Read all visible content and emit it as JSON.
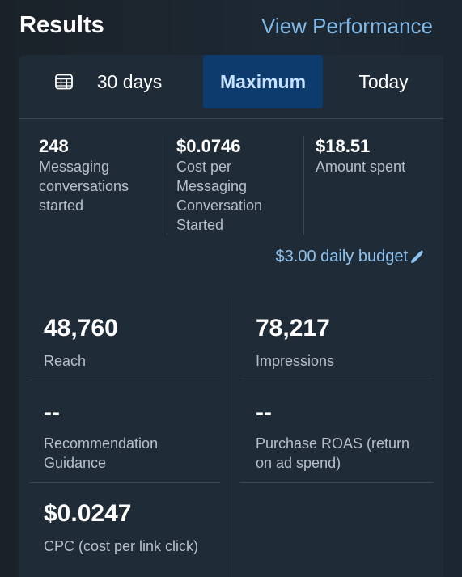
{
  "header": {
    "title": "Results",
    "link": "View Performance"
  },
  "tabs": [
    {
      "label": "30 days",
      "icon": "calendar-icon"
    },
    {
      "label": "Maximum",
      "selected": true
    },
    {
      "label": "Today"
    }
  ],
  "summary": [
    {
      "value": "248",
      "label": "Messaging conversations started"
    },
    {
      "value": "$0.0746",
      "label": "Cost per Messaging Conversation Started"
    },
    {
      "value": "$18.51",
      "label": "Amount spent"
    }
  ],
  "budget": {
    "label": "$3.00 daily budget",
    "icon": "pencil-icon"
  },
  "metrics": [
    {
      "value": "48,760",
      "label": "Reach"
    },
    {
      "value": "78,217",
      "label": "Impressions"
    },
    {
      "value": "--",
      "label": "Recommendation Guidance"
    },
    {
      "value": "--",
      "label": "Purchase ROAS (return on ad spend)"
    },
    {
      "value": "$0.0247",
      "label": "CPC (cost per link click)"
    }
  ],
  "colors": {
    "accent": "#7fb8e6",
    "selected_tab_bg": "#0d3b6e",
    "card_bg": "#1f2b36"
  }
}
